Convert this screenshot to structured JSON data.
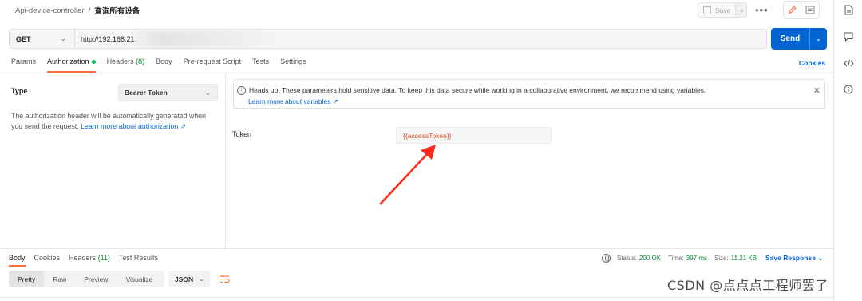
{
  "breadcrumb": {
    "parent": "Api-device-controller",
    "separator": "/",
    "current": "查询所有设备"
  },
  "toolbar": {
    "save_label": "Save",
    "more_label": "•••"
  },
  "request": {
    "method": "GET",
    "url": "http://192.168.21.",
    "send_label": "Send"
  },
  "request_tabs": [
    {
      "label": "Params"
    },
    {
      "label": "Authorization"
    },
    {
      "label": "Headers",
      "count": "(8)"
    },
    {
      "label": "Body"
    },
    {
      "label": "Pre-request Script"
    },
    {
      "label": "Tests"
    },
    {
      "label": "Settings"
    }
  ],
  "cookies_label": "Cookies",
  "auth": {
    "type_label": "Type",
    "type_value": "Bearer Token",
    "description": "The authorization header will be automatically generated when you send the request. ",
    "learn_more": "Learn more about authorization ↗",
    "banner_text": "Heads up! These parameters hold sensitive data. To keep this data secure while working in a collaborative environment, we recommend using variables.",
    "banner_link": "Learn more about variables ↗",
    "token_label": "Token",
    "token_value": "{{accessToken}}"
  },
  "response": {
    "tabs": [
      {
        "label": "Body"
      },
      {
        "label": "Cookies"
      },
      {
        "label": "Headers",
        "count": "(11)"
      },
      {
        "label": "Test Results"
      }
    ],
    "status_label": "Status:",
    "status_value": "200 OK",
    "time_label": "Time:",
    "time_value": "397 ms",
    "size_label": "Size:",
    "size_value": "11.21 KB",
    "save_response": "Save Response",
    "formats": [
      "Pretty",
      "Raw",
      "Preview",
      "Visualize"
    ],
    "format_type": "JSON"
  },
  "watermark": "CSDN @点点点工程师罢了",
  "colors": {
    "accent": "#ff6c37",
    "primary": "#0265d2",
    "success": "#0a8a3a",
    "arrow": "#ff2a1a"
  }
}
